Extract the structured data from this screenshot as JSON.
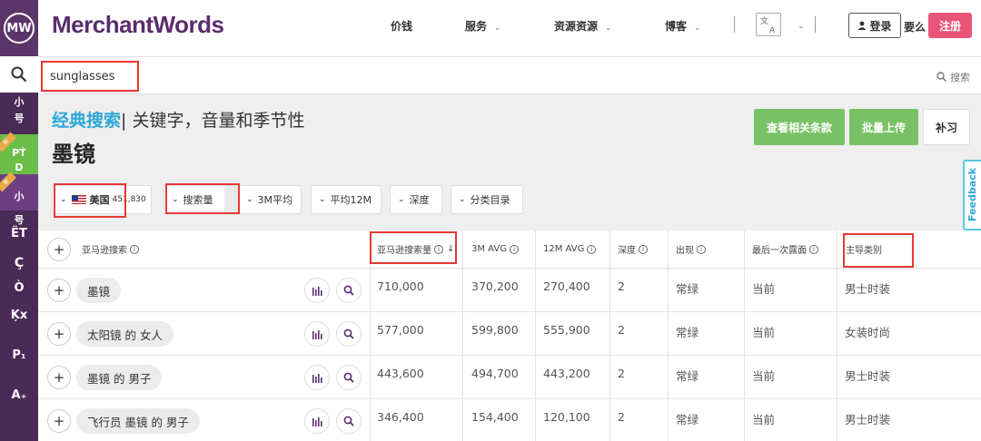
{
  "brand": {
    "logo_text": "MW",
    "name": "MerchantWords"
  },
  "nav": {
    "items": [
      {
        "label": "价钱",
        "has_chevron": false
      },
      {
        "label": "服务",
        "has_chevron": true
      },
      {
        "label": "资源资源",
        "has_chevron": true
      },
      {
        "label": "博客",
        "has_chevron": true
      }
    ],
    "chevron": "⌄",
    "login": "登录",
    "or": "要么",
    "signup": "注册"
  },
  "sidebar": {
    "items": [
      {
        "label": "小"
      },
      {
        "label": "号"
      },
      {
        "label": "PṪ"
      },
      {
        "label": "D"
      },
      {
        "label": "小"
      },
      {
        "label": "号"
      },
      {
        "label": "ËT"
      },
      {
        "label": "Ç"
      },
      {
        "label": "Ò"
      },
      {
        "label": "Ķx"
      },
      {
        "label": "P₁"
      },
      {
        "label": "A₊"
      }
    ],
    "ribbon": "新"
  },
  "search": {
    "value": "sunglasses",
    "right_label": "搜索"
  },
  "heading": {
    "accent": "经典搜索",
    "rest": "关键字，音量和季节性",
    "keyword": "墨镜"
  },
  "actions": {
    "related": "查看相关条款",
    "bulk": "批量上传",
    "supplement": "补习"
  },
  "filters": {
    "country": "美国",
    "country_count": "451,830",
    "volume": "搜索量",
    "avg3m": "3M平均",
    "avg12m": "平均12M",
    "depth": "深度",
    "category": "分类目录"
  },
  "table": {
    "headers": {
      "search": "亚马逊搜索",
      "volume": "亚马逊搜索量",
      "avg3m": "3M AVG",
      "avg12m": "12M AVG",
      "depth": "深度",
      "appear": "出现",
      "last_seen": "最后一次露面",
      "category": "主导类别"
    },
    "rows": [
      {
        "keyword": "墨镜",
        "volume": "710,000",
        "avg3m": "370,200",
        "avg12m": "270,400",
        "depth": "2",
        "appear": "常绿",
        "last": "当前",
        "category": "男士时装"
      },
      {
        "keyword": "太阳镜 的 女人",
        "volume": "577,000",
        "avg3m": "599,800",
        "avg12m": "555,900",
        "depth": "2",
        "appear": "常绿",
        "last": "当前",
        "category": "女装时尚"
      },
      {
        "keyword": "墨镜 的 男子",
        "volume": "443,600",
        "avg3m": "494,700",
        "avg12m": "443,200",
        "depth": "2",
        "appear": "常绿",
        "last": "当前",
        "category": "男士时装"
      },
      {
        "keyword": "飞行员 墨镜 的 男子",
        "volume": "346,400",
        "avg3m": "154,400",
        "avg12m": "120,100",
        "depth": "2",
        "appear": "常绿",
        "last": "当前",
        "category": "男士时装"
      }
    ]
  },
  "feedback": "Feedback",
  "colors": {
    "brand": "#5a2d6e",
    "sidebar": "#4a2a56",
    "accent_blue": "#2fa8d8",
    "green": "#78c265",
    "pink": "#e95579",
    "annotation_red": "#e53935"
  }
}
